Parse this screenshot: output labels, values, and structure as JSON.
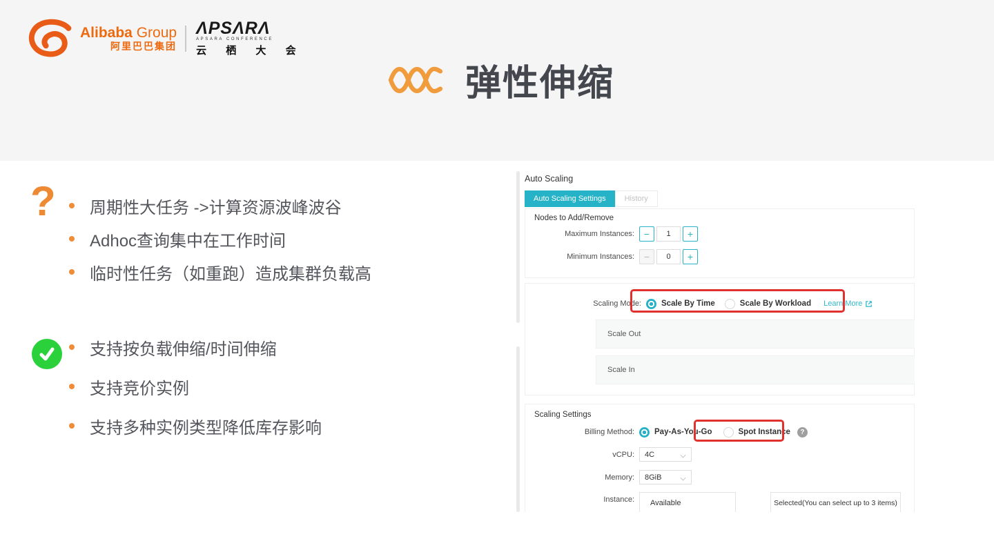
{
  "header": {
    "alibaba": {
      "name_en_bold": "Alibaba",
      "name_en_light": "Group",
      "name_cn": "阿里巴巴集团"
    },
    "apsara": {
      "wordmark": "ΛPSΛRΛ",
      "subtitle": "APSARA CONFERENCE",
      "name_cn": "云 栖 大 会"
    }
  },
  "slide": {
    "title": "弹性伸缩",
    "pain_points": [
      "周期性大任务 ->计算资源波峰波谷",
      "Adhoc查询集中在工作时间",
      "临时性任务（如重跑）造成集群负载高"
    ],
    "capabilities": [
      "支持按负载伸缩/时间伸缩",
      "支持竞价实例",
      "支持多种实例类型降低库存影响"
    ]
  },
  "console": {
    "title": "Auto Scaling",
    "tabs": [
      {
        "label": "Auto Scaling Settings",
        "active": true
      },
      {
        "label": "History",
        "active": false
      }
    ],
    "nodes": {
      "heading": "Nodes to Add/Remove",
      "max_label": "Maximum Instances:",
      "max_value": "1",
      "min_label": "Minimum Instances:",
      "min_value": "0"
    },
    "scaling_mode": {
      "label": "Scaling Mode:",
      "option_time": "Scale By Time",
      "option_workload": "Scale By Workload",
      "selected": "Scale By Time",
      "learn_more": "Learn More",
      "panel_out": "Scale Out",
      "panel_in": "Scale In"
    },
    "scaling_settings": {
      "heading": "Scaling Settings",
      "billing_label": "Billing Method:",
      "billing_payg": "Pay-As-You-Go",
      "billing_spot": "Spot Instance",
      "billing_selected": "Pay-As-You-Go",
      "vcpu_label": "vCPU:",
      "vcpu_value": "4C",
      "memory_label": "Memory:",
      "memory_value": "8GiB",
      "instance_label": "Instance:",
      "available_label": "Available",
      "selected_label": "Selected(You can select up to 3 items)"
    }
  },
  "icons": {
    "minus": "−",
    "plus": "+",
    "question": "?",
    "help": "?"
  },
  "colors": {
    "accent": "#27b3c7",
    "highlight": "#e1312e",
    "orange": "#ed8a33",
    "green": "#2bd13b"
  }
}
